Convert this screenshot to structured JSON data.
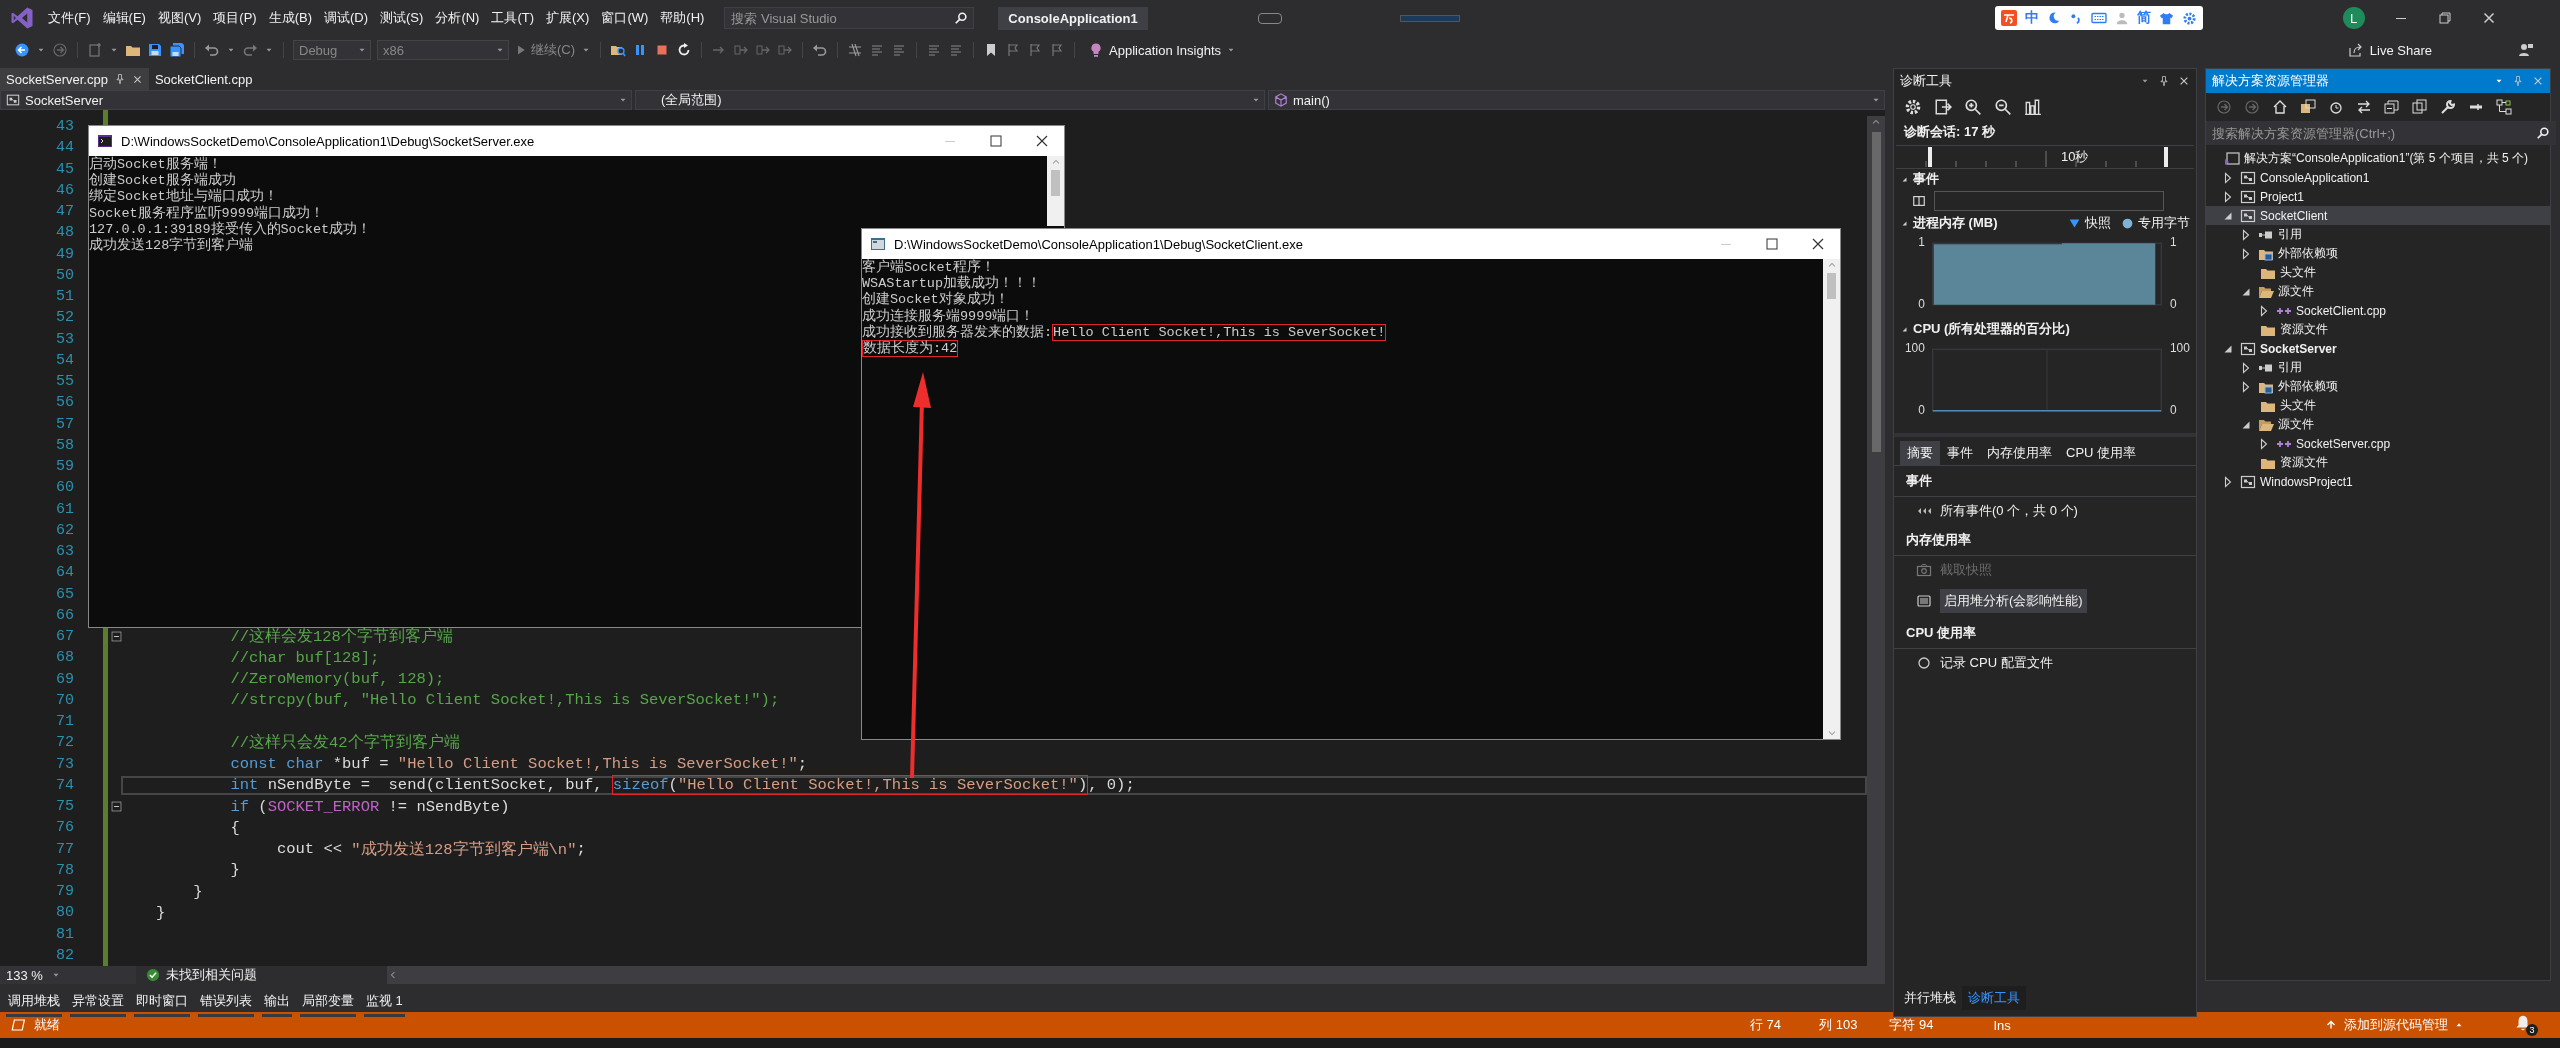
{
  "title_bar": {
    "menu": [
      "文件(F)",
      "编辑(E)",
      "视图(V)",
      "项目(P)",
      "生成(B)",
      "调试(D)",
      "测试(S)",
      "分析(N)",
      "工具(T)",
      "扩展(X)",
      "窗口(W)",
      "帮助(H)"
    ],
    "search": {
      "placeholder": "搜索 Visual Studio"
    },
    "solution_name": "ConsoleApplication1",
    "ime_bar": {
      "mode": "中",
      "script": "简"
    },
    "account_initial": "L",
    "live_share": "Live Share"
  },
  "toolbar": {
    "configuration": "Debug",
    "platform": "x86",
    "continue": "继续(C)",
    "insights": "Application Insights"
  },
  "editor": {
    "tabs": [
      {
        "label": "SocketServer.cpp",
        "selected": true
      },
      {
        "label": "SocketClient.cpp",
        "selected": false
      }
    ],
    "nav": {
      "project": "SocketServer",
      "scope": "(全局范围)",
      "member": "main()"
    },
    "lines": [
      {
        "number": "43",
        "fold": false,
        "current": false
      },
      {
        "number": "44",
        "fold": false,
        "current": false
      },
      {
        "number": "45",
        "fold": false,
        "current": false
      },
      {
        "number": "46",
        "fold": false,
        "current": false
      },
      {
        "number": "47",
        "fold": false,
        "current": false
      },
      {
        "number": "48",
        "fold": false,
        "current": false
      },
      {
        "number": "49",
        "fold": false,
        "current": false
      },
      {
        "number": "50",
        "fold": false,
        "current": false
      },
      {
        "number": "51",
        "fold": false,
        "current": false
      },
      {
        "number": "52",
        "fold": false,
        "current": false
      },
      {
        "number": "53",
        "fold": false,
        "current": false
      },
      {
        "number": "54",
        "fold": false,
        "current": false
      },
      {
        "number": "55",
        "fold": false,
        "current": false
      },
      {
        "number": "56",
        "fold": false,
        "current": false
      },
      {
        "number": "57",
        "fold": false,
        "current": false
      },
      {
        "number": "58",
        "fold": false,
        "current": false
      },
      {
        "number": "59",
        "fold": false,
        "current": false
      },
      {
        "number": "60",
        "fold": false,
        "current": false
      },
      {
        "number": "61",
        "fold": false,
        "current": false
      },
      {
        "number": "62",
        "fold": false,
        "current": false
      },
      {
        "number": "63",
        "fold": false,
        "current": false
      },
      {
        "number": "64",
        "fold": false,
        "current": false
      },
      {
        "number": "65",
        "fold": false,
        "current": false
      },
      {
        "number": "66",
        "fold": false,
        "current": false
      },
      {
        "number": "67",
        "fold": true,
        "current": false,
        "tokens": [
          {
            "kind": "comment",
            "text": "        //这样会发128个字节到客户端",
            "boxed": false
          }
        ]
      },
      {
        "number": "68",
        "fold": false,
        "current": false,
        "tokens": [
          {
            "kind": "comment",
            "text": "        //char buf[128];",
            "boxed": false
          }
        ]
      },
      {
        "number": "69",
        "fold": false,
        "current": false,
        "tokens": [
          {
            "kind": "comment",
            "text": "        //ZeroMemory(buf, 128);",
            "boxed": false
          }
        ]
      },
      {
        "number": "70",
        "fold": false,
        "current": false,
        "tokens": [
          {
            "kind": "comment",
            "text": "        //strcpy(buf, \"Hello Client Socket!,This is SeverSocket!\");",
            "boxed": false
          }
        ]
      },
      {
        "number": "71",
        "fold": false,
        "current": false
      },
      {
        "number": "72",
        "fold": false,
        "current": false,
        "tokens": [
          {
            "kind": "comment",
            "text": "        //这样只会发42个字节到客户端",
            "boxed": false
          }
        ]
      },
      {
        "number": "73",
        "fold": false,
        "current": false,
        "tokens": [
          {
            "kind": "keyword",
            "text": "        const char",
            "boxed": false
          },
          {
            "kind": "plain",
            "text": " *buf = ",
            "boxed": false
          },
          {
            "kind": "string",
            "text": "\"Hello Client Socket!,This is SeverSocket!\"",
            "boxed": false
          },
          {
            "kind": "plain",
            "text": ";",
            "boxed": false
          }
        ]
      },
      {
        "number": "74",
        "fold": false,
        "current": true,
        "tokens": [
          {
            "kind": "keyword",
            "text": "        int",
            "boxed": false
          },
          {
            "kind": "plain",
            "text": " nSendByte =  send(clientSocket, buf, ",
            "boxed": false
          },
          {
            "kind": "keyword",
            "text": "sizeof",
            "boxed": true
          },
          {
            "kind": "plain",
            "text": "(",
            "boxed": true
          },
          {
            "kind": "string",
            "text": "\"Hello Client Socket!,This is SeverSocket!\"",
            "boxed": true
          },
          {
            "kind": "plain",
            "text": ")",
            "boxed": true
          },
          {
            "kind": "plain",
            "text": ", 0);",
            "boxed": false
          }
        ]
      },
      {
        "number": "75",
        "fold": true,
        "current": false,
        "tokens": [
          {
            "kind": "keyword",
            "text": "        if",
            "boxed": false
          },
          {
            "kind": "plain",
            "text": " (",
            "boxed": false
          },
          {
            "kind": "macro",
            "text": "SOCKET_ERROR",
            "boxed": false
          },
          {
            "kind": "plain",
            "text": " != nSendByte)",
            "boxed": false
          }
        ]
      },
      {
        "number": "76",
        "fold": false,
        "current": false,
        "tokens": [
          {
            "kind": "plain",
            "text": "        {",
            "boxed": false
          }
        ]
      },
      {
        "number": "77",
        "fold": false,
        "current": false,
        "tokens": [
          {
            "kind": "plain",
            "text": "             cout << ",
            "boxed": false
          },
          {
            "kind": "string",
            "text": "\"成功发送128字节到客户端\\n\"",
            "boxed": false
          },
          {
            "kind": "plain",
            "text": ";",
            "boxed": false
          }
        ]
      },
      {
        "number": "78",
        "fold": false,
        "current": false,
        "tokens": [
          {
            "kind": "plain",
            "text": "        }",
            "boxed": false
          }
        ]
      },
      {
        "number": "79",
        "fold": false,
        "current": false,
        "tokens": [
          {
            "kind": "plain",
            "text": "    }",
            "boxed": false
          }
        ]
      },
      {
        "number": "80",
        "fold": false,
        "current": false,
        "tokens": [
          {
            "kind": "plain",
            "text": "}",
            "boxed": false
          }
        ]
      },
      {
        "number": "81",
        "fold": false,
        "current": false
      },
      {
        "number": "82",
        "fold": false,
        "current": false
      }
    ],
    "zoom": "133 %",
    "issues": "未找到相关问题"
  },
  "bottom_tabs": [
    "调用堆栈",
    "异常设置",
    "即时窗口",
    "错误列表",
    "输出",
    "局部变量",
    "监视 1"
  ],
  "server_console": {
    "title": "D:\\WindowsSocketDemo\\ConsoleApplication1\\Debug\\SocketServer.exe",
    "lines": [
      {
        "parts": [
          {
            "text": "启动Socket服务端！",
            "boxed": false
          }
        ]
      },
      {
        "parts": [
          {
            "text": "创建Socket服务端成功",
            "boxed": false
          }
        ]
      },
      {
        "parts": [
          {
            "text": "绑定Socket地址与端口成功！",
            "boxed": false
          }
        ]
      },
      {
        "parts": [
          {
            "text": "Socket服务程序监听9999端口成功！",
            "boxed": false
          }
        ]
      },
      {
        "parts": [
          {
            "text": "127.0.0.1:39189接受传入的Socket成功！",
            "boxed": false
          }
        ]
      },
      {
        "parts": [
          {
            "text": "成功发送128字节到客户端",
            "boxed": false
          }
        ]
      }
    ]
  },
  "client_console": {
    "title": "D:\\WindowsSocketDemo\\ConsoleApplication1\\Debug\\SocketClient.exe",
    "lines": [
      {
        "parts": [
          {
            "text": "客户端Socket程序！",
            "boxed": false
          }
        ]
      },
      {
        "parts": [
          {
            "text": "WSAStartup加载成功！！！",
            "boxed": false
          }
        ]
      },
      {
        "parts": [
          {
            "text": "创建Socket对象成功！",
            "boxed": false
          }
        ]
      },
      {
        "parts": [
          {
            "text": "成功连接服务端9999端口！",
            "boxed": false
          }
        ]
      },
      {
        "parts": [
          {
            "text": "成功接收到服务器发来的数据:",
            "boxed": false
          },
          {
            "text": "Hello Client Socket!,This is SeverSocket!",
            "boxed": true
          }
        ]
      },
      {
        "parts": [
          {
            "text": "数据长度为:42",
            "boxed": true
          }
        ]
      }
    ]
  },
  "diagnostics": {
    "title": "诊断工具",
    "session": "诊断会话: 17 秒",
    "timeline_label": "10秒",
    "events_title": "事件",
    "memory": {
      "title": "进程内存 (MB)",
      "legend": [
        {
          "label": "快照",
          "kind": "snapshot"
        },
        {
          "label": "专用字节",
          "kind": "private"
        }
      ],
      "left_axis_labels": [
        "1",
        "0"
      ],
      "right_axis_labels": [
        "1",
        "0"
      ]
    },
    "cpu": {
      "title": "CPU (所有处理器的百分比)",
      "right_axis_labels": [
        "100",
        "0"
      ],
      "chart_data": {
        "type": "line",
        "ylim": [
          0,
          100
        ],
        "yticks": [
          0,
          100
        ],
        "series": [
          {
            "color": "#4e8ab3",
            "values": [
              0,
              0,
              0,
              0,
              0,
              0,
              0,
              0,
              0,
              0,
              0,
              0
            ]
          }
        ]
      }
    },
    "tabs": [
      {
        "label": "摘要",
        "selected": true
      },
      {
        "label": "事件",
        "selected": false
      },
      {
        "label": "内存使用率",
        "selected": false
      },
      {
        "label": "CPU 使用率",
        "selected": false
      }
    ],
    "sections": [
      {
        "title": "事件",
        "items": [
          {
            "kind": "events",
            "label": "所有事件(0 个，共 0 个)",
            "disabled": false
          }
        ]
      },
      {
        "title": "内存使用率",
        "items": [
          {
            "kind": "snapshot",
            "label": "截取快照",
            "disabled": true
          },
          {
            "kind": "heap",
            "label": "启用堆分析(会影响性能)",
            "disabled": false
          }
        ]
      },
      {
        "title": "CPU 使用率",
        "items": [
          {
            "kind": "record",
            "label": "记录 CPU 配置文件",
            "disabled": false
          }
        ]
      }
    ],
    "bottom_tabs": [
      {
        "label": "并行堆栈",
        "selected": false
      },
      {
        "label": "诊断工具",
        "selected": true
      }
    ]
  },
  "solution_explorer": {
    "title": "解决方案资源管理器",
    "search": {
      "placeholder": "搜索解决方案资源管理器(Ctrl+;)"
    },
    "tree": [
      {
        "label": "解决方案“ConsoleApplication1”(第 5 个项目，共 5 个)",
        "kind": "solution",
        "selected": false,
        "children": [
          {
            "label": "ConsoleApplication1",
            "kind": "project",
            "selected": false,
            "expanded": false,
            "startup": false
          },
          {
            "label": "Project1",
            "kind": "project",
            "selected": false,
            "expanded": false,
            "startup": false
          },
          {
            "label": "SocketClient",
            "kind": "project",
            "selected": true,
            "expanded": true,
            "startup": false,
            "children": [
              {
                "label": "引用",
                "kind": "references",
                "selected": false,
                "expanded": false
              },
              {
                "label": "外部依赖项",
                "kind": "dependencies",
                "selected": false,
                "expanded": false
              },
              {
                "label": "头文件",
                "kind": "folder",
                "selected": false
              },
              {
                "label": "源文件",
                "kind": "source-folder",
                "selected": false,
                "expanded": true,
                "children": [
                  {
                    "label": "SocketClient.cpp",
                    "kind": "file",
                    "selected": false,
                    "expanded": false
                  }
                ]
              },
              {
                "label": "资源文件",
                "kind": "folder",
                "selected": false
              }
            ]
          },
          {
            "label": "SocketServer",
            "kind": "project",
            "selected": false,
            "expanded": true,
            "startup": true,
            "children": [
              {
                "label": "引用",
                "kind": "references",
                "selected": false,
                "expanded": false
              },
              {
                "label": "外部依赖项",
                "kind": "dependencies",
                "selected": false,
                "expanded": false
              },
              {
                "label": "头文件",
                "kind": "folder",
                "selected": false
              },
              {
                "label": "源文件",
                "kind": "source-folder",
                "selected": false,
                "expanded": true,
                "children": [
                  {
                    "label": "SocketServer.cpp",
                    "kind": "file",
                    "selected": false,
                    "expanded": false
                  }
                ]
              },
              {
                "label": "资源文件",
                "kind": "folder",
                "selected": false
              }
            ]
          },
          {
            "label": "WindowsProject1",
            "kind": "project",
            "selected": false,
            "expanded": false,
            "startup": false
          }
        ]
      }
    ]
  },
  "status_bar": {
    "state": "就绪",
    "line": "行 74",
    "column": "列 103",
    "char": "字符 94",
    "mode": "Ins",
    "source_control": "添加到源代码管理",
    "notifications": "3"
  }
}
